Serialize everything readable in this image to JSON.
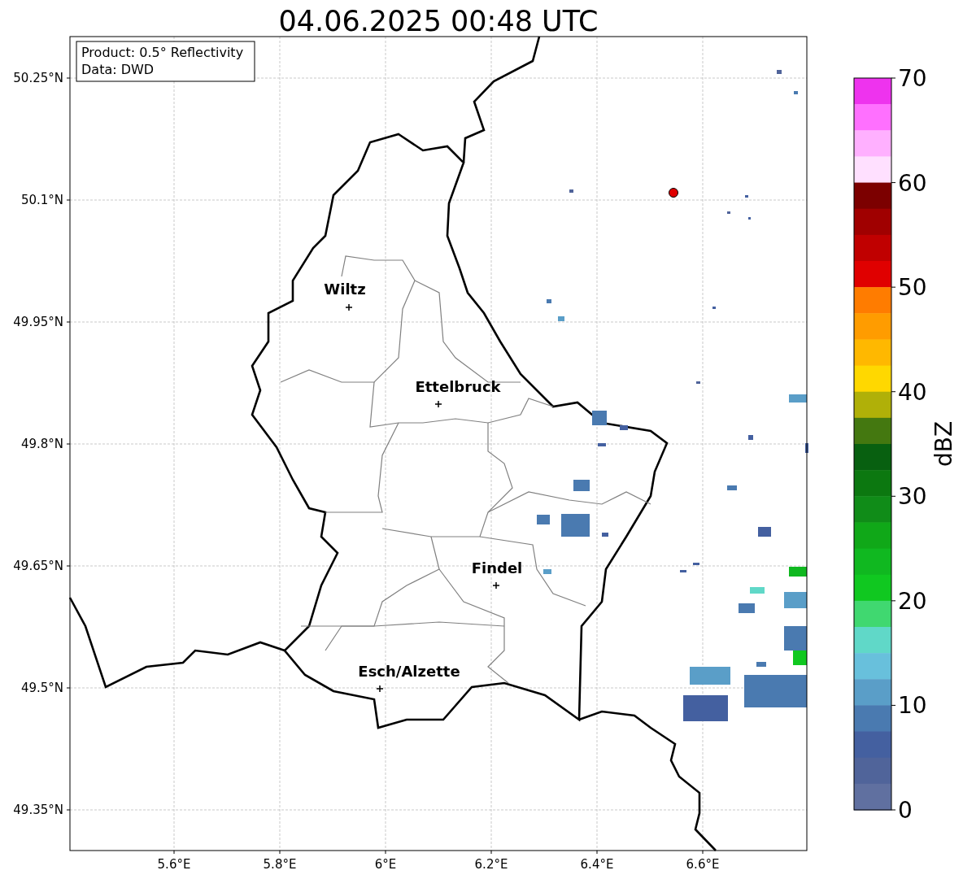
{
  "title": "04.06.2025 00:48 UTC",
  "info_box": [
    "Product: 0.5° Reflectivity",
    "Data: DWD"
  ],
  "map": {
    "lon_ticks": [
      "5.6°E",
      "5.8°E",
      "6°E",
      "6.2°E",
      "6.4°E",
      "6.6°E"
    ],
    "lat_ticks": [
      "50.25°N",
      "50.1°N",
      "49.95°N",
      "49.8°N",
      "49.65°N",
      "49.5°N",
      "49.35°N"
    ],
    "cities": [
      {
        "name": "Wiltz"
      },
      {
        "name": "Ettelbruck"
      },
      {
        "name": "Findel"
      },
      {
        "name": "Esch/Alzette"
      }
    ]
  },
  "colorbar": {
    "label": "dBZ",
    "ticks": [
      "70",
      "60",
      "50",
      "40",
      "30",
      "20",
      "10",
      "0"
    ],
    "bins": [
      {
        "color": "#ee33ee"
      },
      {
        "color": "#ff70ff"
      },
      {
        "color": "#ffb0ff"
      },
      {
        "color": "#ffe0ff"
      },
      {
        "color": "#7c0000"
      },
      {
        "color": "#a00000"
      },
      {
        "color": "#c00000"
      },
      {
        "color": "#e00000"
      },
      {
        "color": "#ff7c00"
      },
      {
        "color": "#ff9c00"
      },
      {
        "color": "#ffb800"
      },
      {
        "color": "#ffd800"
      },
      {
        "color": "#b0b008"
      },
      {
        "color": "#447810"
      },
      {
        "color": "#086010"
      },
      {
        "color": "#0c7810"
      },
      {
        "color": "#108c18"
      },
      {
        "color": "#10a818"
      },
      {
        "color": "#10b820"
      },
      {
        "color": "#10c820"
      },
      {
        "color": "#40d870"
      },
      {
        "color": "#60d8c8"
      },
      {
        "color": "#68c0dc"
      },
      {
        "color": "#5a9ec8"
      },
      {
        "color": "#4a7ab0"
      },
      {
        "color": "#4460a0"
      },
      {
        "color": "#50649a"
      },
      {
        "color": "#6070a0"
      }
    ]
  }
}
